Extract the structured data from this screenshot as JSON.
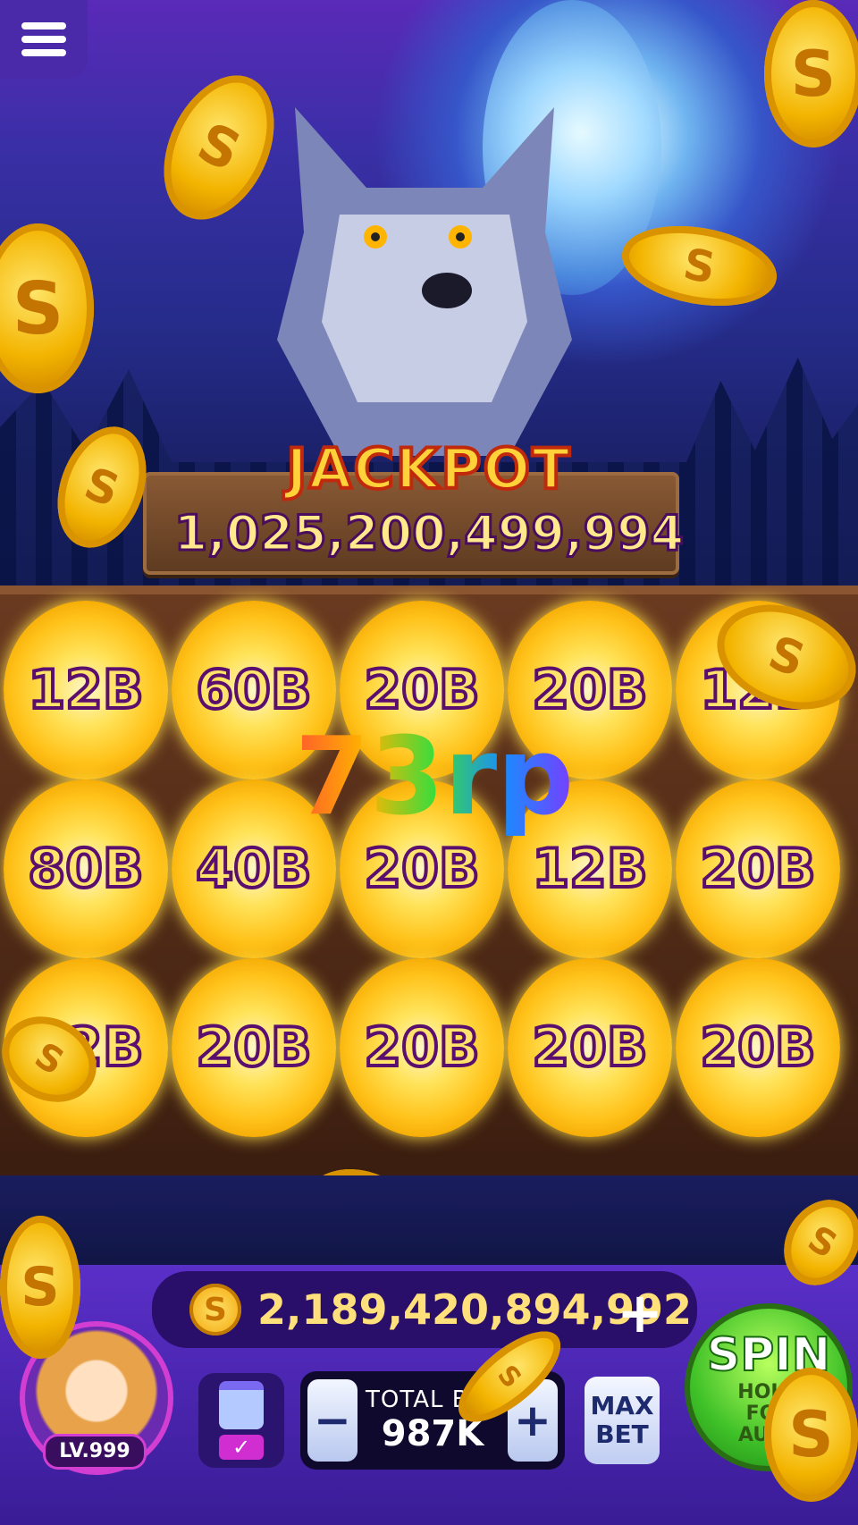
{
  "jackpot": {
    "title": "JACKPOT",
    "value": "1,025,200,499,994"
  },
  "reels": [
    [
      "12B",
      "60B",
      "20B",
      "20B",
      "12B"
    ],
    [
      "80B",
      "40B",
      "20B",
      "12B",
      "20B"
    ],
    [
      "12B",
      "20B",
      "20B",
      "20B",
      "20B"
    ]
  ],
  "overlay_text": "73rp",
  "balance": {
    "coin_symbol": "S",
    "value": "2,189,420,894,992",
    "add_label": "+"
  },
  "player": {
    "level": "LV.999"
  },
  "bet": {
    "label": "TOTAL BET",
    "value": "987K",
    "decrease": "−",
    "increase": "+"
  },
  "max_bet": {
    "line1": "MAX",
    "line2": "BET"
  },
  "spin": {
    "label": "SPIN",
    "sub": "HOLD FOR AUTO"
  },
  "colors": {
    "accent_gold": "#ffd23a",
    "panel_purple": "#4a2aa8",
    "spin_green": "#3fc128"
  }
}
